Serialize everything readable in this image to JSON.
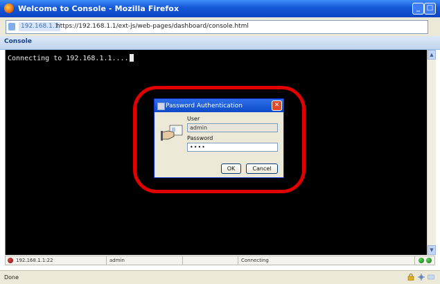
{
  "window": {
    "title": "Welcome to Console - Mozilla Firefox"
  },
  "urlbar": {
    "host_label": "192.168.1.1",
    "url": "https://192.168.1.1/ext-js/web-pages/dashboard/console.html"
  },
  "panel": {
    "header": "Console"
  },
  "terminal": {
    "text": "Connecting to 192.168.1.1...."
  },
  "dialog": {
    "title": "Password Authentication",
    "user_label": "User",
    "user_value": "admin",
    "password_label": "Password",
    "password_value": "••••",
    "ok_label": "OK",
    "cancel_label": "Cancel"
  },
  "status_row": {
    "address": "192.168.1.1:22",
    "user": "admin",
    "state": "Connecting"
  },
  "browser_status": {
    "text": "Done"
  },
  "colors": {
    "highlight_ring": "#e00000",
    "terminal_bg": "#000000",
    "titlebar": "#1457d6"
  },
  "icons": [
    "firefox-icon",
    "minimize-icon",
    "maximize-icon",
    "site-identity-icon",
    "bookmark-star-icon",
    "scroll-up-icon",
    "scroll-down-icon",
    "disconnected-status-icon",
    "dialog-app-icon",
    "close-icon",
    "auth-hand-card-icon",
    "connection-status-icons",
    "lock-icon",
    "tools-icon",
    "status-icon"
  ]
}
